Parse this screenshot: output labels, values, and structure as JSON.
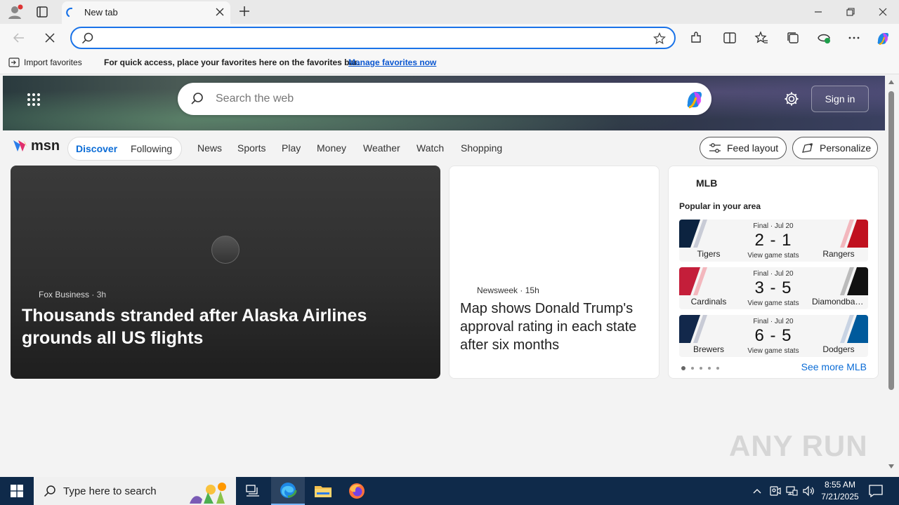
{
  "browser": {
    "tab_title": "New tab",
    "address_value": "",
    "favorites": {
      "import_label": "Import favorites",
      "message": "For quick access, place your favorites here on the favorites bar.",
      "manage_link": "Manage favorites now"
    }
  },
  "msn": {
    "search_placeholder": "Search the web",
    "sign_in": "Sign in",
    "logo_text": "msn",
    "nav": {
      "discover": "Discover",
      "following": "Following",
      "links": [
        "News",
        "Sports",
        "Play",
        "Money",
        "Weather",
        "Watch",
        "Shopping"
      ],
      "feed_layout": "Feed layout",
      "personalize": "Personalize"
    },
    "main_story": {
      "source": "Fox Business",
      "age": "3h",
      "headline": "Thousands stranded after Alaska Airlines grounds all US flights"
    },
    "second_story": {
      "source": "Newsweek",
      "age": "15h",
      "headline": "Map shows Donald Trump's approval rating in each state after six months"
    },
    "sports": {
      "league": "MLB",
      "subtitle": "Popular in your area",
      "games": [
        {
          "status": "Final · Jul 20",
          "score": "2 - 1",
          "stats": "View game stats",
          "home": "Tigers",
          "away": "Rangers",
          "home_color": "#0c2340",
          "away_color": "#c0111f"
        },
        {
          "status": "Final · Jul 20",
          "score": "3 - 5",
          "stats": "View game stats",
          "home": "Cardinals",
          "away": "Diamondbacks",
          "home_color": "#c41e3a",
          "away_color": "#111111"
        },
        {
          "status": "Final · Jul 20",
          "score": "6 - 5",
          "stats": "View game stats",
          "home": "Brewers",
          "away": "Dodgers",
          "home_color": "#12284b",
          "away_color": "#005a9c"
        }
      ],
      "see_more": "See more MLB"
    }
  },
  "watermark": "ANY RUN",
  "taskbar": {
    "search_placeholder": "Type here to search",
    "time": "8:55 AM",
    "date": "7/21/2025"
  },
  "colors": {
    "accent": "#1a73e8",
    "msn_blue": "#0b6cd6",
    "taskbar": "#0f2a4a"
  }
}
